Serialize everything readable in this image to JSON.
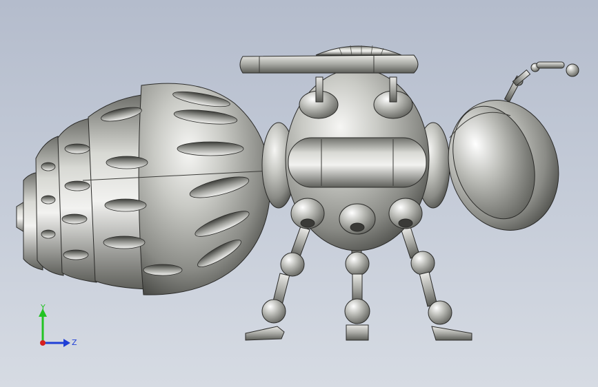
{
  "viewport": {
    "background_top": "#b4bccc",
    "background_bottom": "#d6dbe3"
  },
  "model": {
    "parts": [
      "antenna",
      "wing",
      "abdomen",
      "thorax",
      "head",
      "legs",
      "feet"
    ],
    "metal_light": "#f4f4f2",
    "metal_mid": "#a6a7a2",
    "metal_dark": "#4a4b47",
    "edge_color": "#2a2a28"
  },
  "triad": {
    "y_label": "Y",
    "z_label": "Z",
    "y_color": "#22c322",
    "z_color": "#1f3fd6",
    "origin_color": "#d61f1f"
  }
}
